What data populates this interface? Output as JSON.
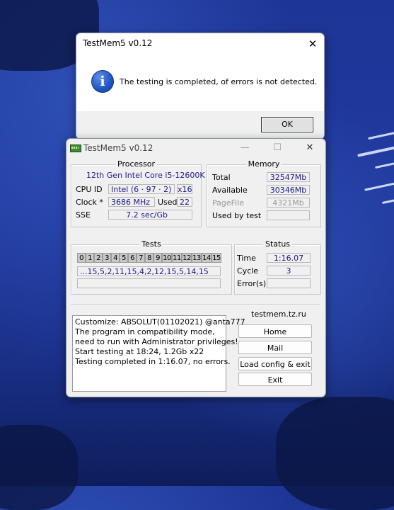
{
  "message_box": {
    "title": "TestMem5 v0.12",
    "close_glyph": "✕",
    "icon": "info-icon",
    "icon_glyph": "i",
    "text": "The testing is completed, of errors is not detected.",
    "ok_label": "OK"
  },
  "main_window": {
    "title": "TestMem5 v0.12",
    "minimize_glyph": "—",
    "maximize_glyph": "☐",
    "close_glyph": "✕",
    "processor": {
      "title": "Processor",
      "name": "12th Gen Intel Core i5-12600K",
      "cpu_id_label": "CPU ID",
      "cpu_id_value": "Intel  (6 · 97 · 2)",
      "cpu_id_threads": "x16",
      "clock_label": "Clock *",
      "clock_value": "3686 MHz",
      "used_label": "Used",
      "used_value": "22",
      "sse_label": "SSE",
      "sse_value": "7.2 sec/Gb"
    },
    "memory": {
      "title": "Memory",
      "total_label": "Total",
      "total_value": "32547Mb",
      "available_label": "Available",
      "available_value": "30346Mb",
      "pagefile_label": "PageFile",
      "pagefile_value": "4321Mb",
      "used_by_test_label": "Used by test",
      "used_by_test_value": ""
    },
    "tests": {
      "title": "Tests",
      "cells": [
        "0",
        "1",
        "2",
        "3",
        "4",
        "5",
        "6",
        "7",
        "8",
        "9",
        "10",
        "11",
        "12",
        "13",
        "14",
        "15"
      ],
      "sequence": "...15,5,2,11,15,4,2,12,15,5,14,15",
      "progress": ""
    },
    "status": {
      "title": "Status",
      "time_label": "Time",
      "time_value": "1:16.07",
      "cycle_label": "Cycle",
      "cycle_value": "3",
      "errors_label": "Error(s)",
      "errors_value": ""
    },
    "log_lines": [
      "Customize: ABSOLUT(01102021) @anta777",
      "The program in compatibility mode,",
      "need to run with Administrator privileges!",
      "Start testing at 18:24, 1.2Gb x22",
      "Testing completed in 1:16.07, no errors."
    ],
    "site": {
      "title": "testmem.tz.ru",
      "home_label": "Home",
      "mail_label": "Mail",
      "load_config_label": "Load config & exit",
      "exit_label": "Exit"
    }
  }
}
